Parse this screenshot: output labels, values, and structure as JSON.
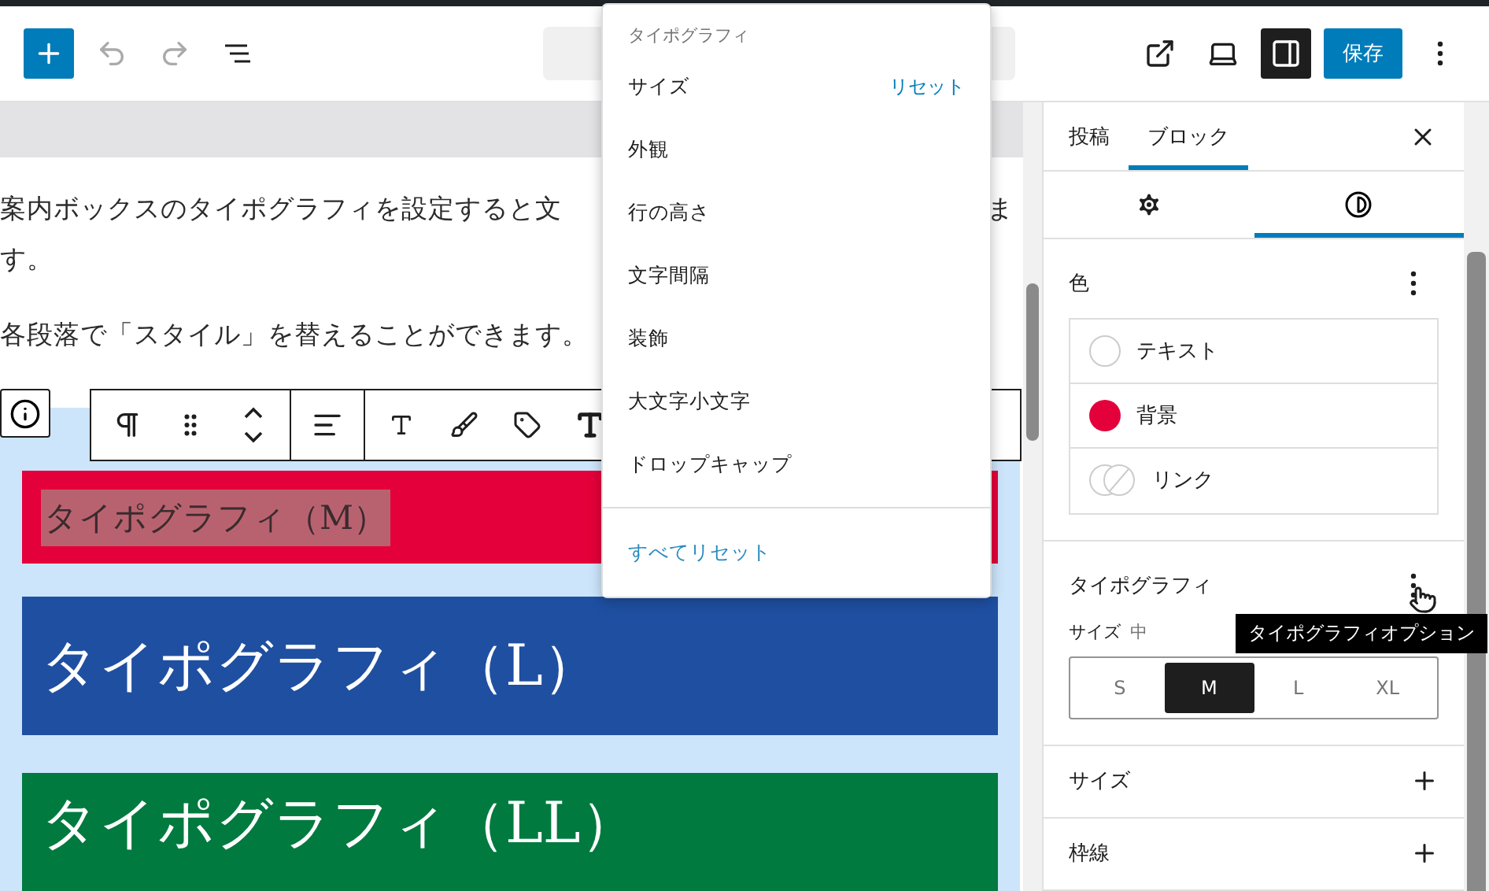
{
  "top_bar": {
    "document_bar": true,
    "save": "保存",
    "sidebar_on": true
  },
  "editor": {
    "paragraphs": [
      {
        "lines": [
          "案内ボックスのタイポグラフィを設定すると文",
          "す。"
        ],
        "tail": "ま"
      },
      {
        "lines": [
          "各段落で「スタイル」を替えることができます。"
        ]
      }
    ],
    "blocks": [
      {
        "text": "タイポグラフィ（M）",
        "kind": "m",
        "color": "#e4003a",
        "highlighted": true
      },
      {
        "text": "タイポグラフィ（L）",
        "kind": "l",
        "color": "#1f4fa1",
        "highlighted": false
      },
      {
        "text": "タイポグラフィ（LL）",
        "kind": "ll",
        "color": "#007a3f",
        "highlighted": false
      }
    ]
  },
  "popover": {
    "title": "タイポグラフィ",
    "items": [
      {
        "label": "サイズ",
        "action": "リセット"
      },
      {
        "label": "外観"
      },
      {
        "label": "行の高さ"
      },
      {
        "label": "文字間隔"
      },
      {
        "label": "装飾"
      },
      {
        "label": "大文字小文字"
      },
      {
        "label": "ドロップキャップ"
      }
    ],
    "reset_all": "すべてリセット"
  },
  "sidebar": {
    "tabs": [
      {
        "label": "投稿",
        "selected": false
      },
      {
        "label": "ブロック",
        "selected": true
      }
    ],
    "icon_tabs": [
      {
        "kind": "settings",
        "selected": false
      },
      {
        "kind": "styles",
        "selected": true
      }
    ],
    "color": {
      "title": "色",
      "items": [
        {
          "label": "テキスト",
          "kind": "empty"
        },
        {
          "label": "背景",
          "kind": "solid",
          "color": "#e4003a"
        },
        {
          "label": "リンク",
          "kind": "pair"
        }
      ]
    },
    "typography": {
      "title": "タイポグラフィ",
      "tooltip": "タイポグラフィオプション",
      "size_label": "サイズ",
      "size_value": "中",
      "sizes": [
        {
          "label": "S",
          "selected": false
        },
        {
          "label": "M",
          "selected": true
        },
        {
          "label": "L",
          "selected": false
        },
        {
          "label": "XL",
          "selected": false
        }
      ]
    },
    "panels": [
      {
        "title": "サイズ"
      },
      {
        "title": "枠線"
      }
    ]
  }
}
